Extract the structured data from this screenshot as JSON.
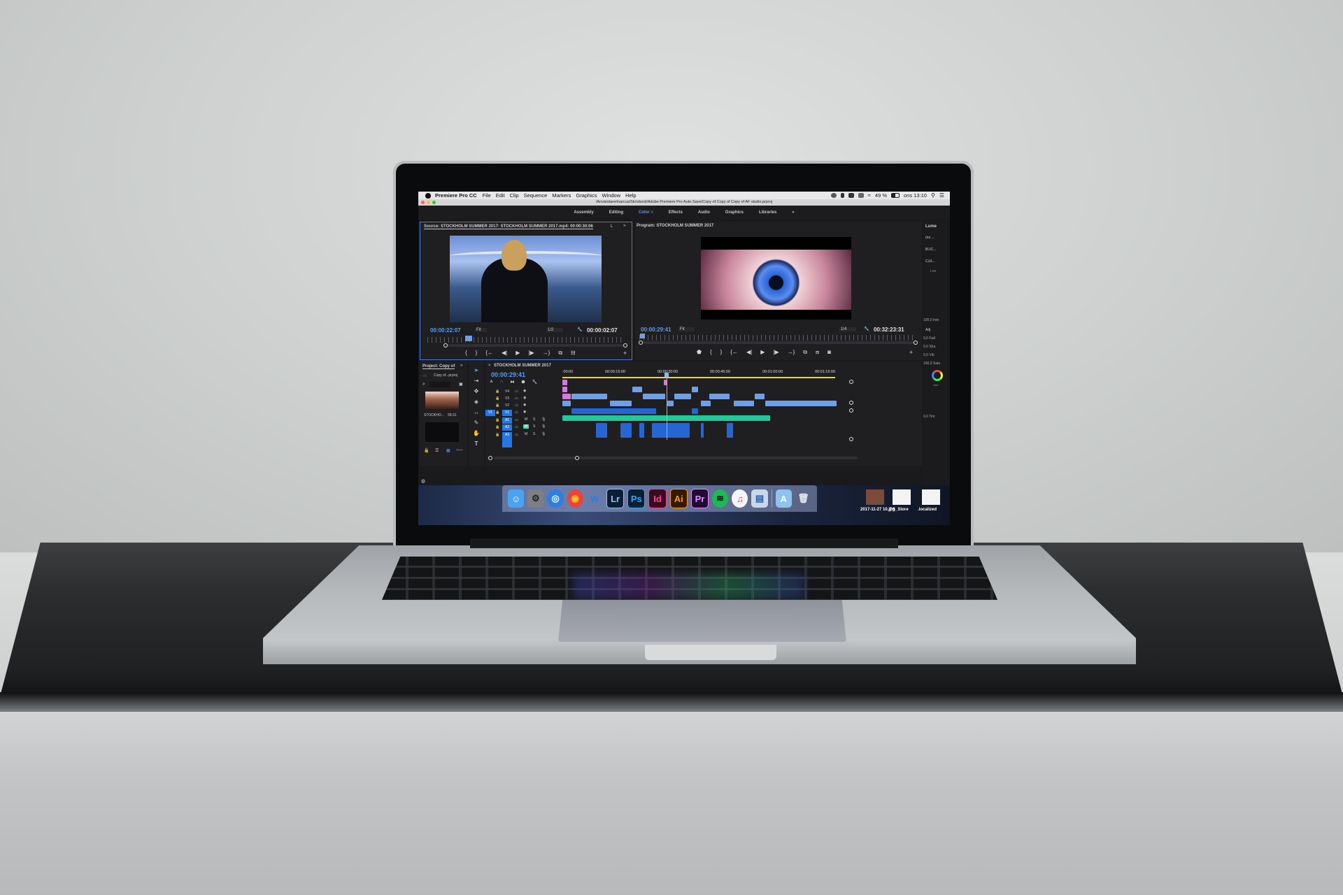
{
  "scene": {
    "description": "MacBook Pro on a desk displaying Adobe Premiere Pro CC"
  },
  "menubar": {
    "app_name": "Premiere Pro CC",
    "items": [
      "File",
      "Edit",
      "Clip",
      "Sequence",
      "Markers",
      "Graphics",
      "Window",
      "Help"
    ],
    "battery": "49 %",
    "clock": "ons 13:10"
  },
  "titlebar": {
    "path": "/Användare/marcus/Skrivbord/Adobe Premiere Pro Auto-Save/Copy of Copy of Copy of AF studio.prproj"
  },
  "workspaces": {
    "tabs": [
      "Assembly",
      "Editing",
      "Color",
      "Effects",
      "Audio",
      "Graphics",
      "Libraries"
    ],
    "active": "Color",
    "more": "»"
  },
  "source_monitor": {
    "title": "Source: STOCKHOLM SUMMER 2017: STOCKHOLM SUMMER 2017.mp4: 00:00:30:06",
    "extra_tab": "L",
    "more": "»",
    "timecode_current": "00:00:22:07",
    "zoom_select": "Fit",
    "resolution_select": "1/2",
    "timecode_duration": "00:00:02:07",
    "controls": [
      "{",
      "}",
      "{←",
      "◀|",
      "▶",
      "|▶",
      "→}",
      "insert",
      "overwrite"
    ],
    "add": "+"
  },
  "program_monitor": {
    "title": "Program: STOCKHOLM SUMMER 2017",
    "timecode_current": "00:00:29:41",
    "zoom_select": "Fit",
    "resolution_select": "1/4",
    "timecode_duration": "00:32:23:31",
    "controls": [
      "marker",
      "{",
      "}",
      "{←",
      "◀|",
      "▶",
      "|▶",
      "→}",
      "lift",
      "extract",
      "camera"
    ],
    "add": "+"
  },
  "lumetri_panel": {
    "title": "Lume",
    "items": [
      "(no ...",
      "B☑C...",
      "C☑t...",
      "Loo",
      "100,0 Inte",
      "Adj",
      "0,0 Fad",
      "0,0 Sha",
      "0,0 Vib",
      "100,0 Satu",
      "0,0 Tint"
    ],
    "wheel_label": "Hue"
  },
  "project_panel": {
    "title": "Project: Copy of",
    "more": "»",
    "file": "Copy of...prproj",
    "clip_name": "STOCKHO...",
    "clip_duration": "59:31"
  },
  "tools": [
    "selection",
    "track-select",
    "ripple",
    "razor",
    "slip",
    "pen",
    "hand",
    "type"
  ],
  "timeline": {
    "title": "STOCKHOLM SUMMER 2017",
    "timecode": "00:00:29:41",
    "ruler_labels": [
      ":00:00",
      "00:00:15:00",
      "00:00:30:00",
      "00:00:45:00",
      "00:01:00:00",
      "00:01:15:00"
    ],
    "video_tracks": [
      "V4",
      "V3",
      "V2",
      "V1"
    ],
    "audio_tracks": [
      "A1",
      "A2",
      "A3"
    ],
    "source_patch": "V1",
    "track_buttons": {
      "mute": "M",
      "solo": "S"
    },
    "total_seconds": 80,
    "playhead_seconds": 29.7,
    "clips": [
      {
        "track": "V4",
        "type": "pink",
        "start": 0,
        "end": 1.5
      },
      {
        "track": "V4",
        "type": "pink",
        "start": 29,
        "end": 30
      },
      {
        "track": "V3",
        "type": "pink",
        "start": 0,
        "end": 1.5
      },
      {
        "track": "V3",
        "type": "video",
        "start": 20,
        "end": 23
      },
      {
        "track": "V3",
        "type": "video",
        "start": 37,
        "end": 39
      },
      {
        "track": "V2",
        "type": "pink",
        "start": 0,
        "end": 2.5
      },
      {
        "track": "V2",
        "type": "video",
        "start": 2.5,
        "end": 13
      },
      {
        "track": "V2",
        "type": "video",
        "start": 23,
        "end": 29.5
      },
      {
        "track": "V2",
        "type": "video",
        "start": 32,
        "end": 37
      },
      {
        "track": "V2",
        "type": "video",
        "start": 42,
        "end": 48
      },
      {
        "track": "V2",
        "type": "video",
        "start": 55,
        "end": 58
      },
      {
        "track": "V1",
        "type": "video",
        "start": 0,
        "end": 2.5
      },
      {
        "track": "V1",
        "type": "video",
        "start": 13.5,
        "end": 20
      },
      {
        "track": "V1",
        "type": "video",
        "start": 30,
        "end": 32
      },
      {
        "track": "V1",
        "type": "video",
        "start": 39.5,
        "end": 42.5
      },
      {
        "track": "V1",
        "type": "video",
        "start": 49,
        "end": 55
      },
      {
        "track": "V1",
        "type": "video",
        "start": 58,
        "end": 78.5
      },
      {
        "track": "A1",
        "type": "audio",
        "start": 2.5,
        "end": 27
      },
      {
        "track": "A1",
        "type": "audio",
        "start": 37,
        "end": 39
      },
      {
        "track": "A2",
        "type": "music",
        "start": 0,
        "end": 59.5
      },
      {
        "track": "A3",
        "type": "audio",
        "start": 9.5,
        "end": 13
      },
      {
        "track": "A3",
        "type": "audio",
        "start": 16.5,
        "end": 20
      },
      {
        "track": "A3",
        "type": "audio",
        "start": 22,
        "end": 23.5
      },
      {
        "track": "A3",
        "type": "audio",
        "start": 25.5,
        "end": 36.5
      },
      {
        "track": "A3",
        "type": "audio",
        "start": 39.5,
        "end": 40.5
      },
      {
        "track": "A3",
        "type": "audio",
        "start": 47,
        "end": 49
      }
    ]
  },
  "dock": {
    "items": [
      {
        "name": "Finder",
        "label": "☺",
        "bg": "#4aa3f0",
        "fg": "#ffffff"
      },
      {
        "name": "System Preferences",
        "label": "⚙",
        "bg": "#7d7f85",
        "fg": "#222222"
      },
      {
        "name": "Safari",
        "label": "◎",
        "bg": "#2d7fe0",
        "fg": "#ffffff"
      },
      {
        "name": "Chrome",
        "label": "◉",
        "bg": "#e8453c",
        "fg": "#f7c51e"
      },
      {
        "name": "Word",
        "label": "W",
        "bg": "transparent",
        "fg": "#2b7de9"
      },
      {
        "name": "Lightroom",
        "label": "Lr",
        "bg": "#0b1e33",
        "fg": "#8ac6f2"
      },
      {
        "name": "Photoshop",
        "label": "Ps",
        "bg": "#0a1f33",
        "fg": "#31a8ff"
      },
      {
        "name": "InDesign",
        "label": "Id",
        "bg": "#3a0a1f",
        "fg": "#ff3c9b"
      },
      {
        "name": "Illustrator",
        "label": "Ai",
        "bg": "#321b02",
        "fg": "#ff9a00"
      },
      {
        "name": "Premiere Pro",
        "label": "Pr",
        "bg": "#230a33",
        "fg": "#e58bff"
      },
      {
        "name": "Spotify",
        "label": "≋",
        "bg": "#1db954",
        "fg": "#111111"
      },
      {
        "name": "iTunes",
        "label": "♫",
        "bg": "#f5f5f5",
        "fg": "#e33a7b"
      },
      {
        "name": "Preview",
        "label": "▤",
        "bg": "#c9d7e8",
        "fg": "#2c5ea8"
      },
      {
        "name": "Applications",
        "label": "A",
        "bg": "#8fc3ef",
        "fg": "#ffffff"
      },
      {
        "name": "Trash",
        "label": "🗑",
        "bg": "transparent",
        "fg": "#e8e8e8"
      }
    ]
  },
  "desktop_files": [
    "2017-11-27 10.jpg",
    ".DS_Store",
    ".localized"
  ],
  "colors": {
    "accent_blue": "#5b9bf0",
    "track_blue": "#2577e8",
    "video_clip": "#6f9fe6",
    "audio_clip": "#2565d4",
    "music_clip": "#25c79a",
    "pink_clip": "#d679dd"
  }
}
